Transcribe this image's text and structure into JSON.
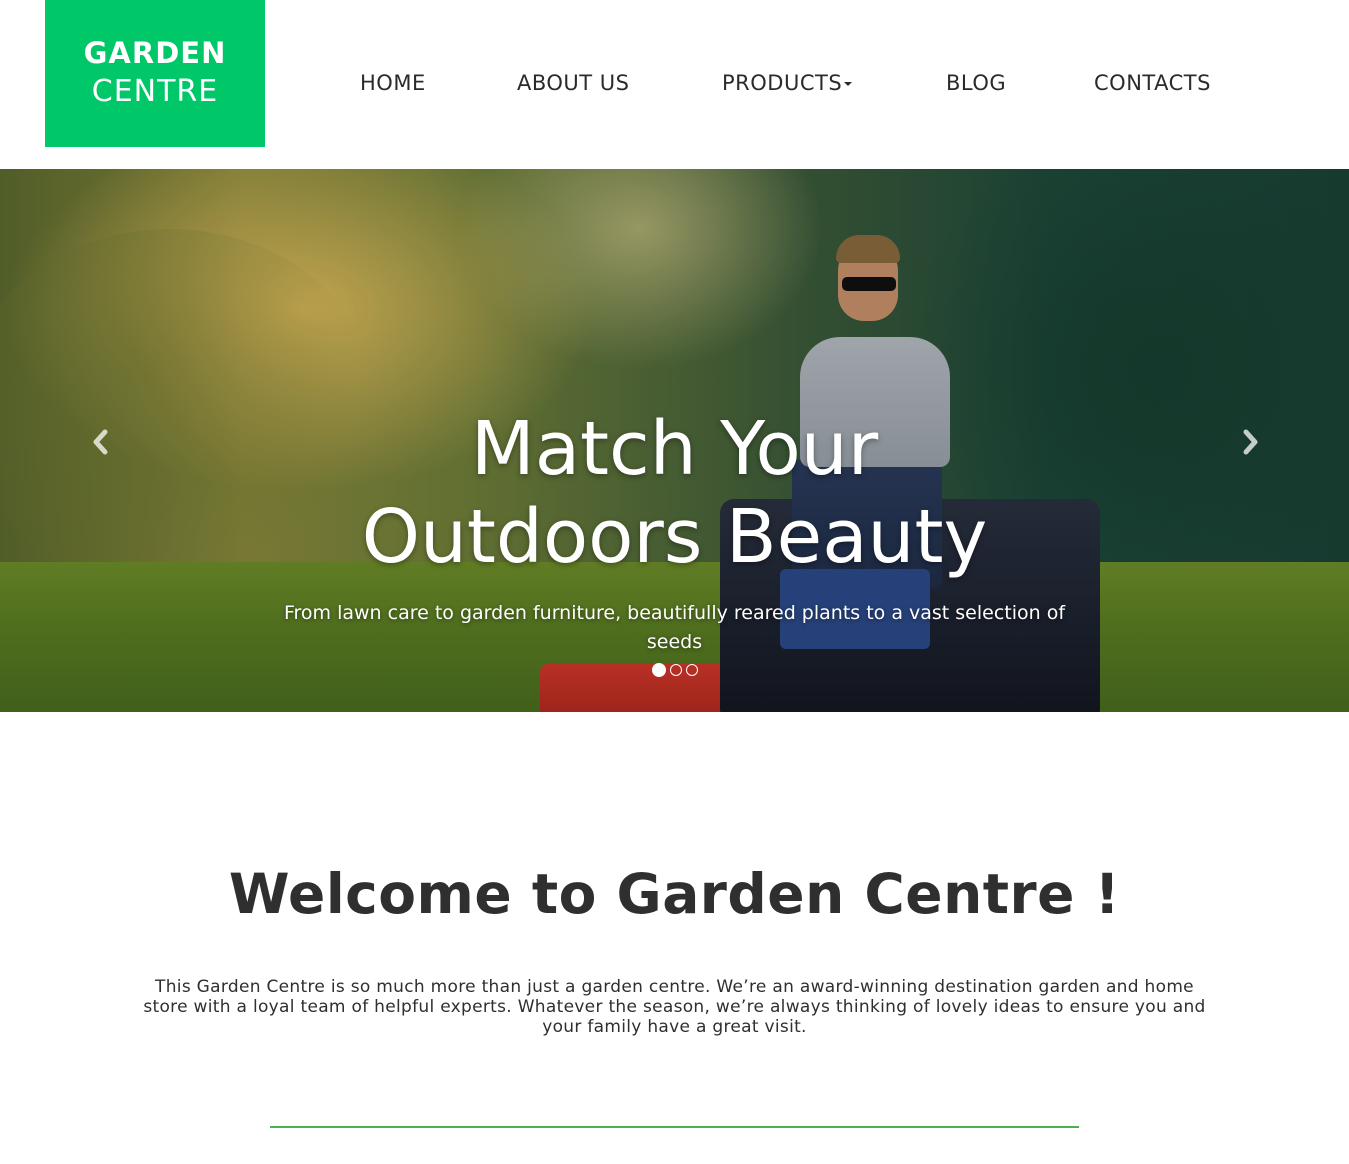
{
  "brand": {
    "logo_line1": "GARDEN",
    "logo_line2": "CENTRE",
    "accent_color": "#00c767"
  },
  "nav": {
    "items": [
      {
        "label": "HOME"
      },
      {
        "label": "ABOUT US"
      },
      {
        "label": "PRODUCTS",
        "has_dropdown": true
      },
      {
        "label": "BLOG"
      },
      {
        "label": "CONTACTS"
      }
    ]
  },
  "hero": {
    "title_line1": "Match Your",
    "title_line2": "Outdoors Beauty",
    "subtitle": "From lawn care to garden furniture, beautifully reared plants to a vast selection of seeds",
    "prev_icon": "chevron-left-icon",
    "next_icon": "chevron-right-icon",
    "slide_count": 3,
    "active_slide": 1
  },
  "welcome": {
    "title": "Welcome to Garden Centre !",
    "body": "This Garden Centre is so much more than just a garden centre. We’re an award-winning destination garden and home store with a loyal team of helpful experts. Whatever the season, we’re always thinking of lovely ideas to ensure you and your family have a great visit.",
    "divider_color": "#4caf50"
  }
}
